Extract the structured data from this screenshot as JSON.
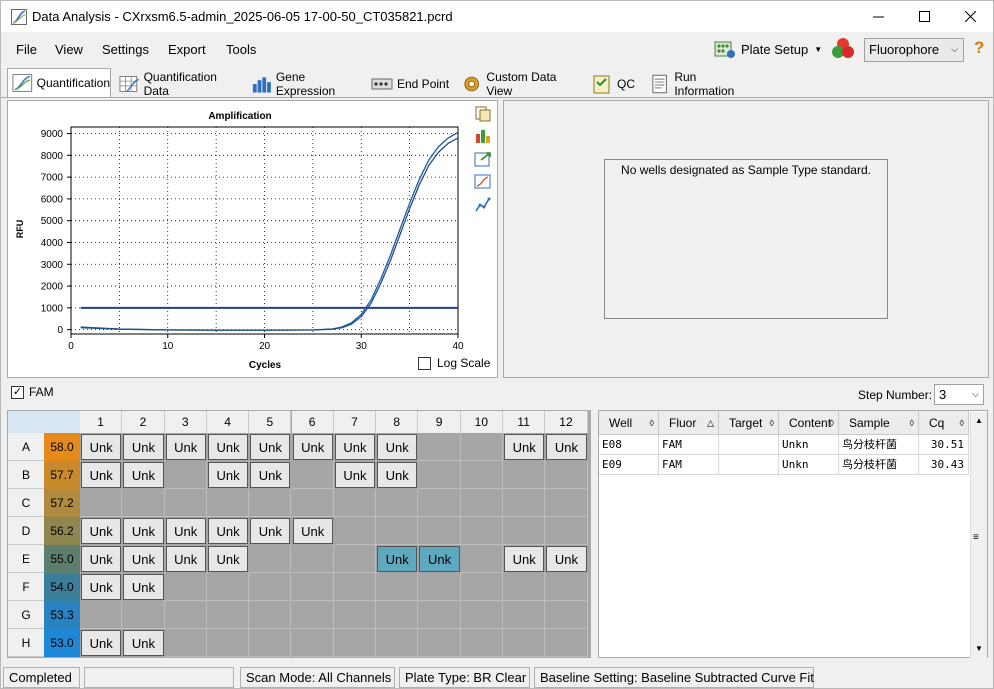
{
  "window": {
    "title": "Data Analysis - CXrxsm6.5-admin_2025-06-05 17-00-50_CT035821.pcrd"
  },
  "menu": [
    "File",
    "View",
    "Settings",
    "Export",
    "Tools"
  ],
  "toolbar": {
    "plate_setup": "Plate Setup",
    "fluorophore": "Fluorophore"
  },
  "tabs": [
    "Quantification",
    "Quantification Data",
    "Gene Expression",
    "End Point",
    "Custom Data View",
    "QC",
    "Run Information"
  ],
  "chart_data": {
    "type": "line",
    "title": "Amplification",
    "xlabel": "Cycles",
    "ylabel": "RFU",
    "xlim": [
      0,
      40
    ],
    "ylim": [
      -200,
      9300
    ],
    "xticks": [
      0,
      10,
      20,
      30,
      40
    ],
    "yticks": [
      0,
      1000,
      2000,
      3000,
      4000,
      5000,
      6000,
      7000,
      8000,
      9000
    ],
    "threshold": 1000,
    "grid": true,
    "series": [
      {
        "x": [
          1,
          5,
          10,
          15,
          20,
          25,
          27,
          28,
          29,
          30,
          31,
          32,
          33,
          34,
          35,
          36,
          37,
          38,
          39,
          40
        ],
        "values": [
          120,
          30,
          -10,
          -20,
          -20,
          -10,
          30,
          120,
          320,
          700,
          1350,
          2300,
          3400,
          4600,
          5800,
          6900,
          7800,
          8400,
          8800,
          9050
        ]
      },
      {
        "x": [
          1,
          5,
          10,
          15,
          20,
          25,
          27,
          28,
          29,
          30,
          31,
          32,
          33,
          34,
          35,
          36,
          37,
          38,
          39,
          40
        ],
        "values": [
          90,
          20,
          -15,
          -25,
          -25,
          -15,
          20,
          90,
          260,
          600,
          1200,
          2100,
          3150,
          4350,
          5550,
          6650,
          7550,
          8150,
          8550,
          8800
        ]
      }
    ],
    "log_scale_label": "Log Scale"
  },
  "standard_message": "No wells designated as Sample Type standard.",
  "fluor_checkbox": "FAM",
  "step_number": {
    "label": "Step Number:",
    "value": "3"
  },
  "plate": {
    "columns": [
      "1",
      "2",
      "3",
      "4",
      "5",
      "6",
      "7",
      "8",
      "9",
      "10",
      "11",
      "12"
    ],
    "rows": [
      {
        "letter": "A",
        "temp": "58.0",
        "tcolor": "#e68b1b",
        "wells": [
          "Unk",
          "Unk",
          "Unk",
          "Unk",
          "Unk",
          "Unk",
          "Unk",
          "Unk",
          "",
          "",
          "Unk",
          "Unk"
        ]
      },
      {
        "letter": "B",
        "temp": "57.7",
        "tcolor": "#c98a2c",
        "wells": [
          "Unk",
          "Unk",
          "",
          "Unk",
          "Unk",
          "",
          "Unk",
          "Unk",
          "",
          "",
          "",
          ""
        ]
      },
      {
        "letter": "C",
        "temp": "57.2",
        "tcolor": "#b08a3e",
        "wells": [
          "",
          "",
          "",
          "",
          "",
          "",
          "",
          "",
          "",
          "",
          "",
          ""
        ]
      },
      {
        "letter": "D",
        "temp": "56.2",
        "tcolor": "#8f8650",
        "wells": [
          "Unk",
          "Unk",
          "Unk",
          "Unk",
          "Unk",
          "Unk",
          "",
          "",
          "",
          "",
          "",
          ""
        ]
      },
      {
        "letter": "E",
        "temp": "55.0",
        "tcolor": "#5c7e6c",
        "wells": [
          "Unk",
          "Unk",
          "Unk",
          "Unk",
          "",
          "",
          "",
          "Unk*",
          "Unk*",
          "",
          "Unk",
          "Unk"
        ]
      },
      {
        "letter": "F",
        "temp": "54.0",
        "tcolor": "#3b7e9b",
        "wells": [
          "Unk",
          "Unk",
          "",
          "",
          "",
          "",
          "",
          "",
          "",
          "",
          "",
          ""
        ]
      },
      {
        "letter": "G",
        "temp": "53.3",
        "tcolor": "#2a82c2",
        "wells": [
          "",
          "",
          "",
          "",
          "",
          "",
          "",
          "",
          "",
          "",
          "",
          ""
        ]
      },
      {
        "letter": "H",
        "temp": "53.0",
        "tcolor": "#1f87d8",
        "wells": [
          "Unk",
          "Unk",
          "",
          "",
          "",
          "",
          "",
          "",
          "",
          "",
          "",
          ""
        ]
      }
    ]
  },
  "table": {
    "headers": [
      "Well",
      "Fluor",
      "Target",
      "Content",
      "Sample",
      "Cq"
    ],
    "rows": [
      [
        "E08",
        "FAM",
        "",
        "Unkn",
        "鸟分枝杆菌",
        "30.51"
      ],
      [
        "E09",
        "FAM",
        "",
        "Unkn",
        "鸟分枝杆菌",
        "30.43"
      ]
    ]
  },
  "status": {
    "state": "Completed",
    "scan_mode": "Scan Mode: All Channels",
    "plate_type": "Plate Type: BR Clear",
    "baseline": "Baseline Setting: Baseline Subtracted Curve Fit"
  }
}
